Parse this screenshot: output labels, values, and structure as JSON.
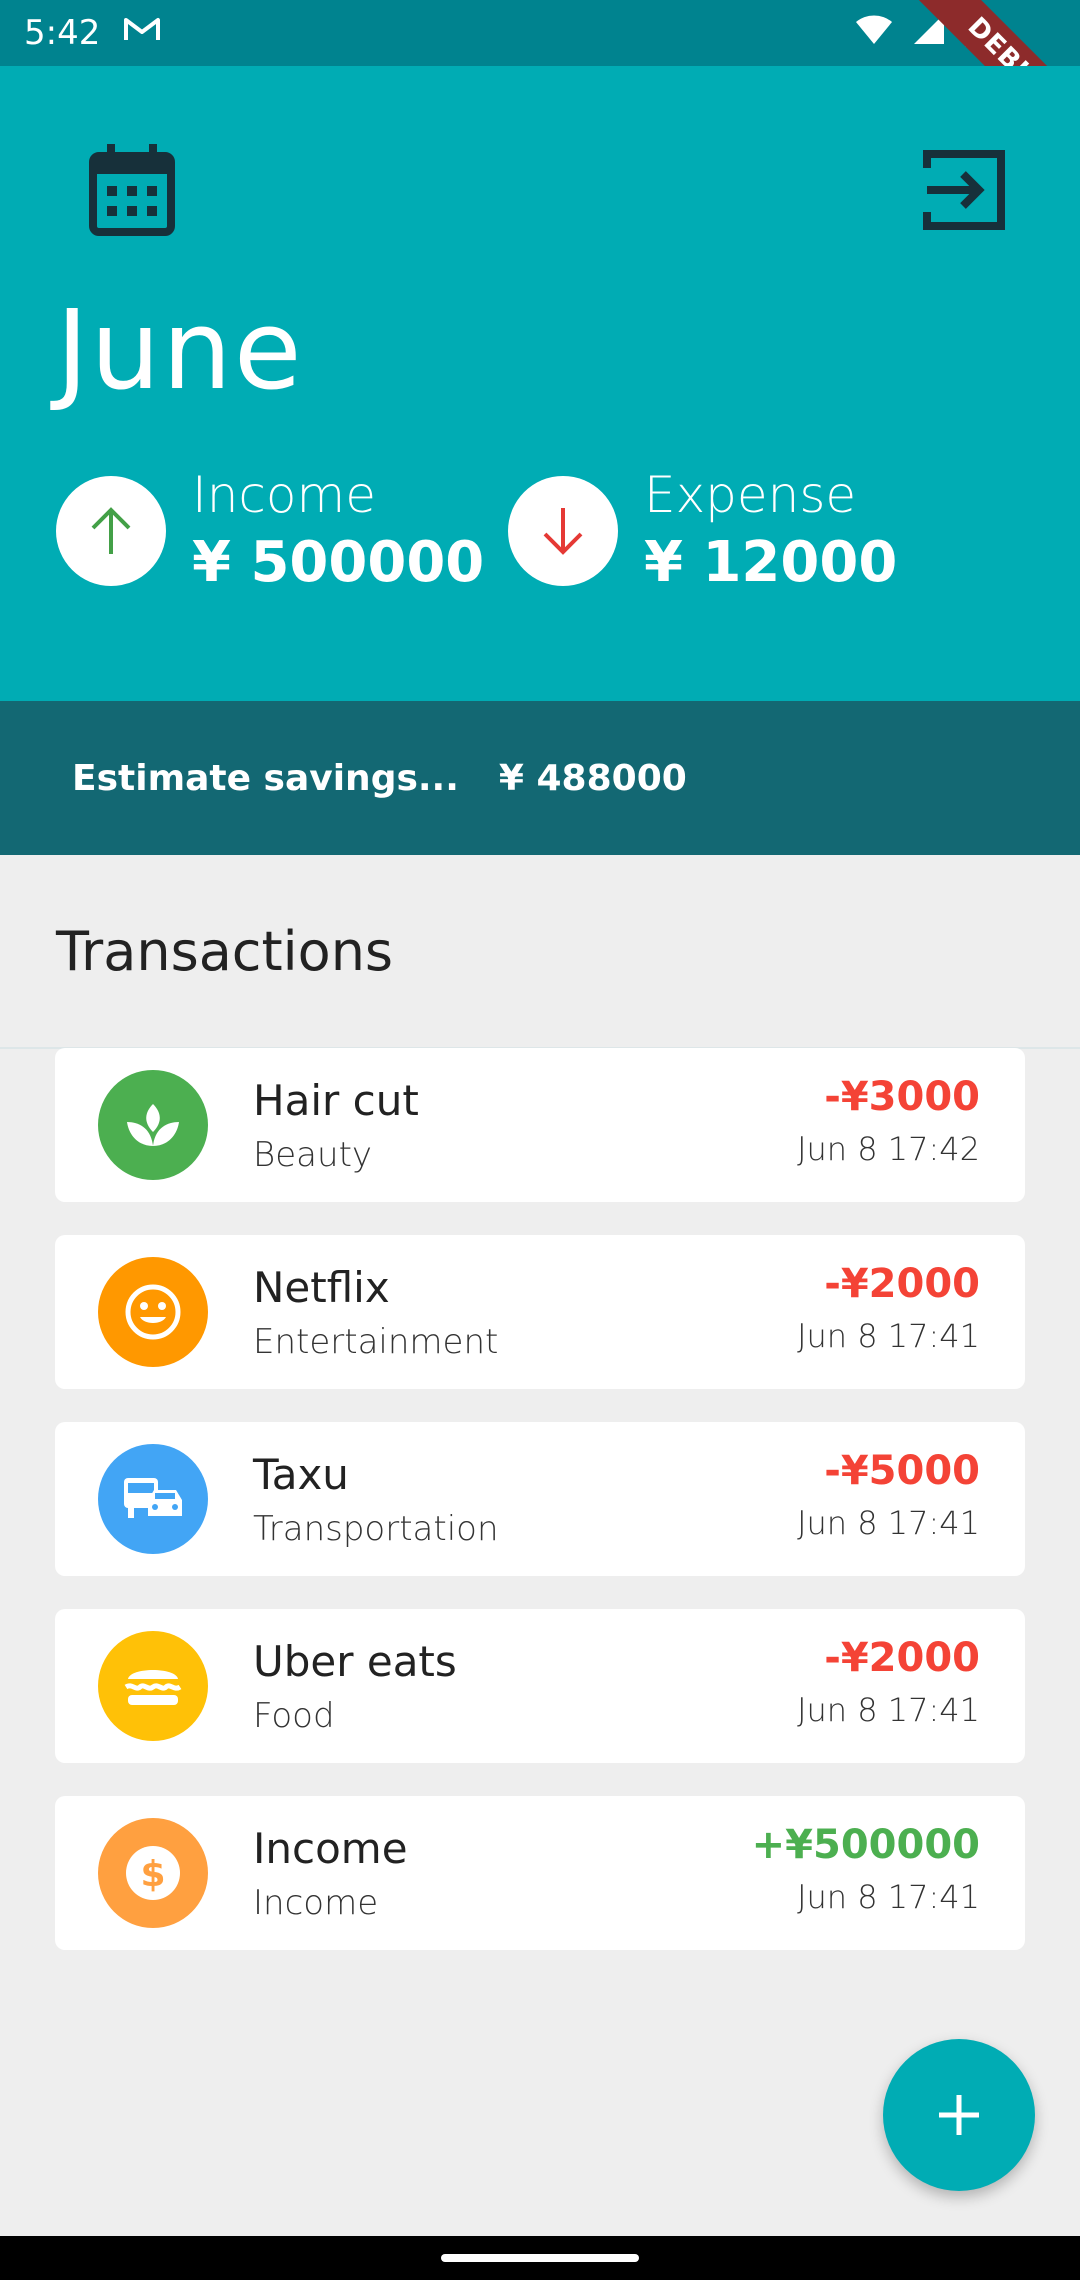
{
  "status_bar": {
    "time": "5:42",
    "debug_label": "DEBUG"
  },
  "header": {
    "month": "June",
    "income": {
      "label": "Income",
      "value": "¥ 500000"
    },
    "expense": {
      "label": "Expense",
      "value": "¥ 12000"
    }
  },
  "savings": {
    "label": "Estimate savings...",
    "value": "¥ 488000"
  },
  "transactions": {
    "title": "Transactions",
    "items": [
      {
        "title": "Hair cut",
        "category": "Beauty",
        "amount": "-¥3000",
        "date": "Jun 8 17:42",
        "icon": "spa-icon",
        "icon_color": "#4caf50",
        "amount_color": "#f44336"
      },
      {
        "title": "Netflix",
        "category": "Entertainment",
        "amount": "-¥2000",
        "date": "Jun 8 17:41",
        "icon": "smiley-icon",
        "icon_color": "#ff9800",
        "amount_color": "#f44336"
      },
      {
        "title": "Taxu",
        "category": "Transportation",
        "amount": "-¥5000",
        "date": "Jun 8 17:41",
        "icon": "transport-icon",
        "icon_color": "#42a5f5",
        "amount_color": "#f44336"
      },
      {
        "title": "Uber eats",
        "category": "Food",
        "amount": "-¥2000",
        "date": "Jun 8 17:41",
        "icon": "burger-icon",
        "icon_color": "#ffc107",
        "amount_color": "#f44336"
      },
      {
        "title": "Income",
        "category": "Income",
        "amount": "+¥500000",
        "date": "Jun 8 17:41",
        "icon": "dollar-icon",
        "icon_color": "#ffa040",
        "amount_color": "#4caf50"
      }
    ]
  },
  "colors": {
    "header": "#00acb4",
    "savings_bar": "#136873",
    "income_arrow": "#43a047",
    "expense_arrow": "#e53935"
  }
}
